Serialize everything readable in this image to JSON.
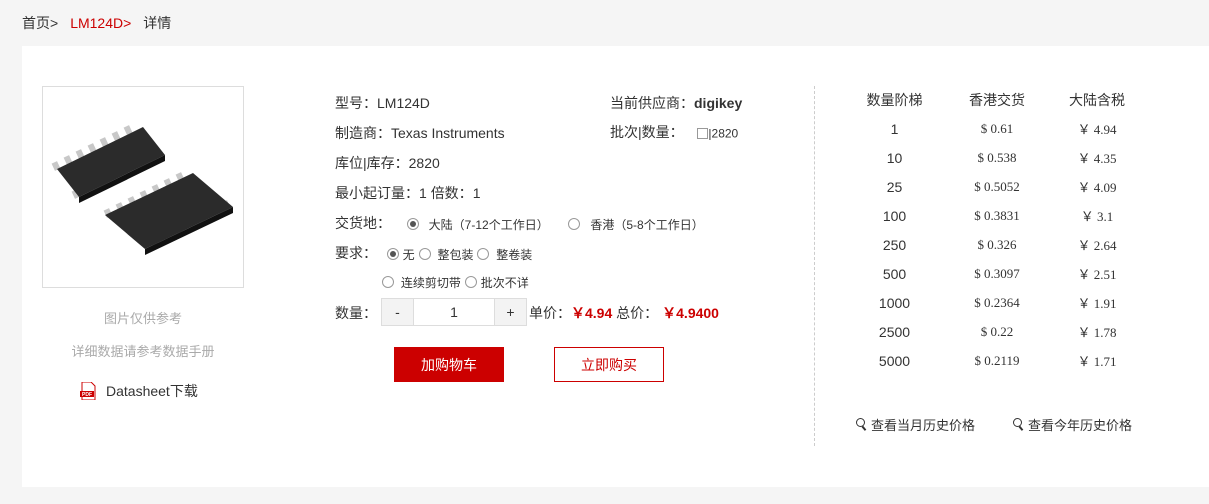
{
  "breadcrumb": {
    "home": "首页",
    "sep": ">",
    "part": "LM124D",
    "current": "详情"
  },
  "image": {
    "note1": "图片仅供参考",
    "note2": "详细数据请参考数据手册",
    "datasheet": "Datasheet下载",
    "pdf_label": "PDF"
  },
  "product": {
    "model_label": "型号：",
    "model": "LM124D",
    "mfr_label": "制造商：",
    "mfr": "Texas Instruments",
    "stock_label": "库位|库存：",
    "stock": "2820",
    "moq_label": "最小起订量：",
    "moq": "1",
    "mult_label": "倍数：",
    "mult": "1",
    "delivery_label": "交货地：",
    "delivery_options": [
      "大陆（7-12个工作日）",
      "香港（5-8个工作日）"
    ],
    "req_label": "要求：",
    "req_options": [
      "无",
      "整包装",
      "整卷装",
      "连续剪切带",
      "批次不详"
    ],
    "supplier_label": "当前供应商：",
    "supplier": "digikey",
    "batch_label": "批次|数量：",
    "batch_value": "|2820",
    "qty_label": "数量：",
    "qty_minus": "-",
    "qty_value": "1",
    "qty_plus": "+",
    "unit_label": "单价：",
    "unit_price": "￥4.94",
    "total_label": "总价：",
    "total_price": "￥4.9400",
    "add_cart": "加购物车",
    "buy_now": "立即购买"
  },
  "price_table": {
    "headers": [
      "数量阶梯",
      "香港交货",
      "大陆含税"
    ],
    "rows": [
      [
        "1",
        "$ 0.61",
        "￥ 4.94"
      ],
      [
        "10",
        "$ 0.538",
        "￥ 4.35"
      ],
      [
        "25",
        "$ 0.5052",
        "￥ 4.09"
      ],
      [
        "100",
        "$ 0.3831",
        "￥ 3.1"
      ],
      [
        "250",
        "$ 0.326",
        "￥ 2.64"
      ],
      [
        "500",
        "$ 0.3097",
        "￥ 2.51"
      ],
      [
        "1000",
        "$ 0.2364",
        "￥ 1.91"
      ],
      [
        "2500",
        "$ 0.22",
        "￥ 1.78"
      ],
      [
        "5000",
        "$ 0.2119",
        "￥ 1.71"
      ]
    ]
  },
  "history": {
    "month": "查看当月历史价格",
    "year": "查看今年历史价格"
  },
  "colors": {
    "accent": "#cc0000"
  }
}
